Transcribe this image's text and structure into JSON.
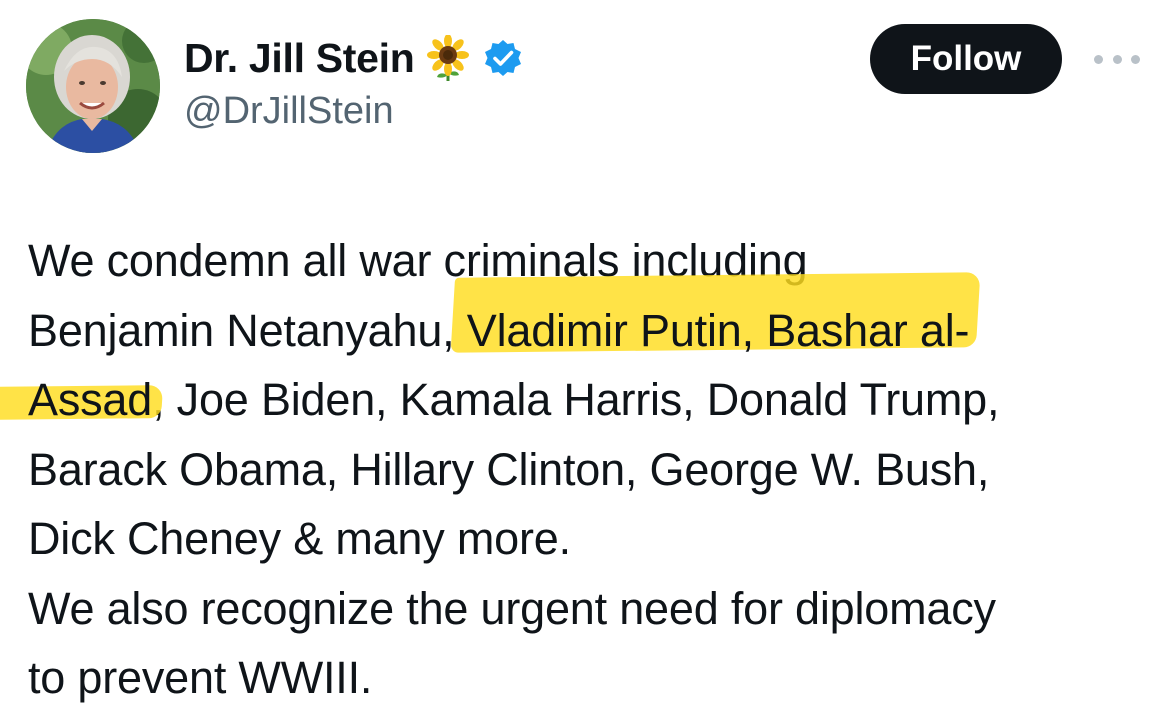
{
  "author": {
    "display_name": "Dr. Jill Stein",
    "handle": "@DrJillStein",
    "name_emoji_icon": "sunflower-icon",
    "verified_icon": "verified-badge-icon",
    "verified_color": "#1d9bf0"
  },
  "actions": {
    "follow_label": "Follow",
    "more_icon": "more-options-icon"
  },
  "tweet": {
    "line1": "We condemn all war criminals including",
    "line2_a": "Benjamin Netanyahu, ",
    "line2_b": "Vladimir Putin, Bashar al-",
    "line3_a": "Assad",
    "line3_b": ", Joe Biden, Kamala Harris, Donald Trump,",
    "line4": "Barack Obama, Hillary Clinton, George W. Bush,",
    "line5": "Dick Cheney & many more.",
    "line6": "We also recognize the urgent need for diplomacy",
    "line7": "to prevent WWIII."
  },
  "colors": {
    "highlight": "#ffdd1e",
    "text": "#0f1419",
    "secondary_text": "#536471",
    "follow_bg": "#0f1419"
  }
}
